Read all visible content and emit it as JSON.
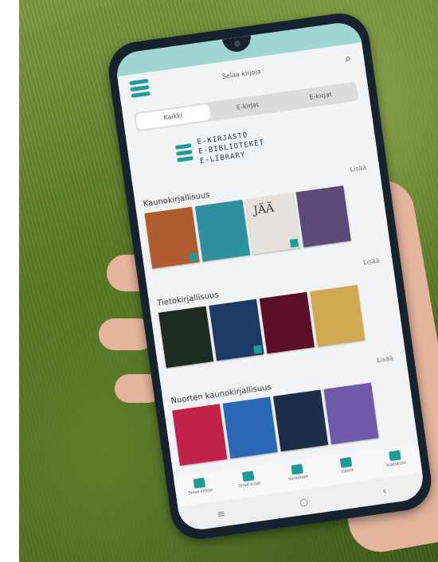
{
  "app": {
    "title": "Selaa kirjoja",
    "tabs": [
      {
        "label": "Kaikki",
        "active": true
      },
      {
        "label": "E-kirjat",
        "active": false
      },
      {
        "label": "E-kirjat",
        "active": false
      }
    ],
    "logo_lines": [
      "E-KIRJASTO",
      "E-BIBLIOTEKET",
      "E-LIBRARY"
    ]
  },
  "sections": [
    {
      "title": "Kaunokirjallisuus",
      "more": "Lisää",
      "books": [
        {
          "title": "",
          "color": "#b05c2e"
        },
        {
          "title": "",
          "color": "#2f8fa0"
        },
        {
          "title": "JÄÄ",
          "color": "#e6e1dc"
        },
        {
          "title": "",
          "color": "#5c4a7a"
        }
      ]
    },
    {
      "title": "Tietokirjallisuus",
      "more": "Lisää",
      "books": [
        {
          "title": "",
          "color": "#1d2b22"
        },
        {
          "title": "",
          "color": "#1d3a66"
        },
        {
          "title": "",
          "color": "#5a0f26"
        },
        {
          "title": "",
          "color": "#d0a850"
        }
      ]
    },
    {
      "title": "Nuorten kaunokirjallisuus",
      "more": "Lisää",
      "books": [
        {
          "title": "",
          "color": "#c2224a"
        },
        {
          "title": "",
          "color": "#2a67b5"
        },
        {
          "title": "",
          "color": "#1c2e4a"
        },
        {
          "title": "",
          "color": "#6e5aa8"
        }
      ]
    }
  ],
  "bottom_nav": [
    {
      "label": "Selaa kirjoja",
      "icon": "book-icon"
    },
    {
      "label": "Omat kirjat",
      "icon": "shelf-icon"
    },
    {
      "label": "Varaukset",
      "icon": "bookmark-icon"
    },
    {
      "label": "Viestit",
      "icon": "mail-icon"
    },
    {
      "label": "Asetukset",
      "icon": "gear-icon"
    }
  ],
  "colors": {
    "accent": "#1e9c9a",
    "status_bar": "#9fd6d3"
  }
}
